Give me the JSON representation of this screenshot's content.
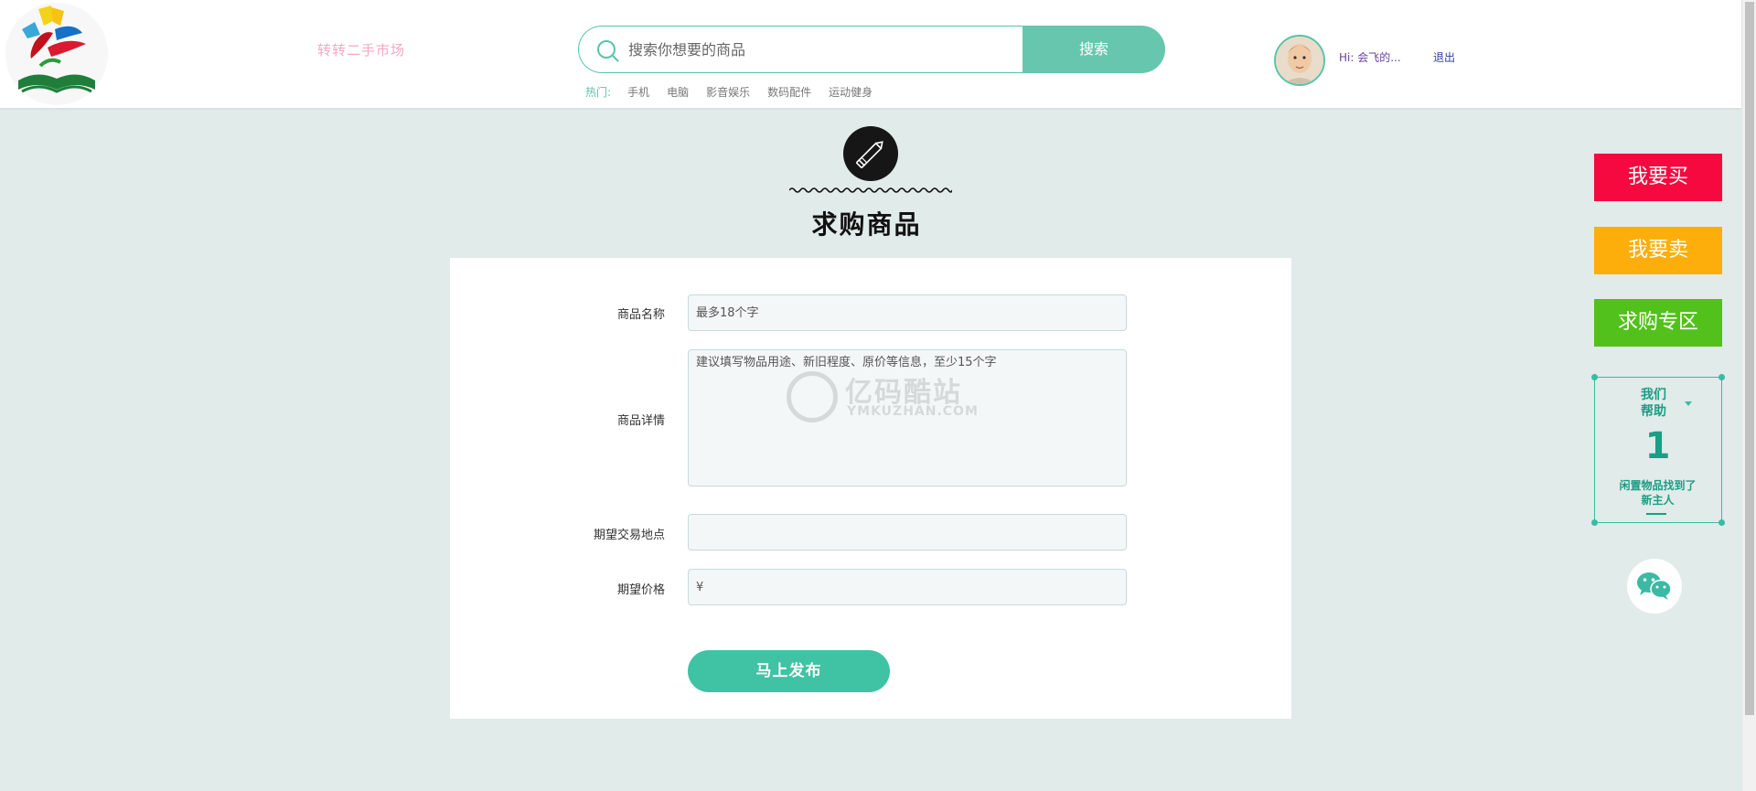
{
  "header": {
    "site_title": "转转二手市场",
    "search_placeholder": "搜索你想要的商品",
    "search_button": "搜索",
    "hot_label": "热门:",
    "hot_links": [
      "手机",
      "电脑",
      "影音娱乐",
      "数码配件",
      "运动健身"
    ],
    "greeting": "Hi: 会飞的...",
    "logout": "退出"
  },
  "page": {
    "title": "求购商品"
  },
  "form": {
    "name_label": "商品名称",
    "name_placeholder": "最多18个字",
    "detail_label": "商品详情",
    "detail_placeholder": "建议填写物品用途、新旧程度、原价等信息，至少15个字",
    "location_label": "期望交易地点",
    "location_placeholder": "",
    "price_label": "期望价格",
    "price_placeholder": "¥",
    "submit": "马上发布"
  },
  "watermark": {
    "text": "亿码酷站",
    "sub": "YMKUZHAN.COM"
  },
  "sidebar": {
    "buy": "我要买",
    "sell": "我要卖",
    "want_zone": "求购专区",
    "help_top_1": "我们",
    "help_top_2": "帮助",
    "help_count": "1",
    "help_desc_1": "闲置物品找到了",
    "help_desc_2": "新主人"
  },
  "colors": {
    "accent": "#59c3a8",
    "buy": "#f5093e",
    "sell": "#fdae0a",
    "want": "#52c11c",
    "page_bg": "#e1ebe9"
  }
}
